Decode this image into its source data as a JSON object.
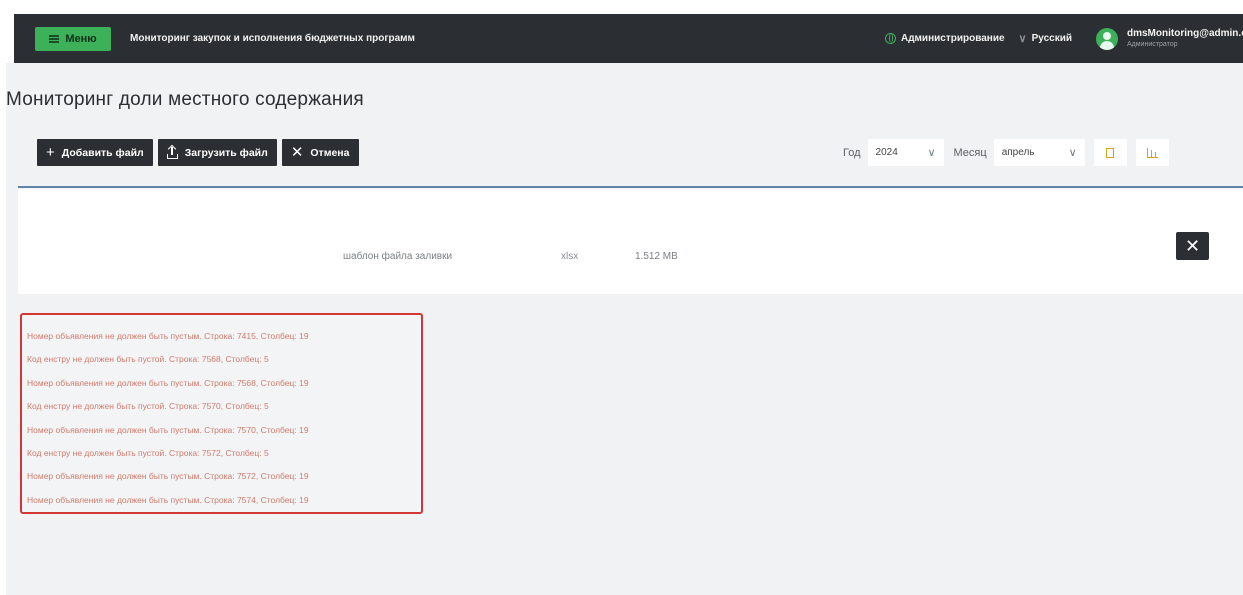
{
  "header": {
    "menu_label": "Меню",
    "app_title": "Мониторинг закупок и исполнения бюджетных программ",
    "admin_label": "Администрирование",
    "language_label": "Русский",
    "user_email": "dmsMonitoring@admin.com",
    "user_role": "Администратор"
  },
  "page": {
    "title": "Мониторинг доли местного содержания"
  },
  "toolbar": {
    "add_file": "Добавить файл",
    "upload_file": "Загрузить файл",
    "cancel": "Отмена"
  },
  "filters": {
    "year_label": "Год",
    "year_value": "2024",
    "month_label": "Месяц",
    "month_value": "апрель"
  },
  "file": {
    "name": "шаблон файла заливки",
    "extension": "xlsx",
    "size": "1.512 MB"
  },
  "errors": [
    "Номер объявления не должен быть пустым. Строка: 7415, Столбец: 19",
    "Код енстру не должен быть пустой. Строка: 7568, Столбец: 5",
    "Номер объявления не должен быть пустым. Строка: 7568, Столбец: 19",
    "Код енстру не должен быть пустой. Строка: 7570, Столбец: 5",
    "Номер объявления не должен быть пустым. Строка: 7570, Столбец: 19",
    "Код енстру не должен быть пустой. Строка: 7572, Столбец: 5",
    "Номер объявления не должен быть пустым. Строка: 7572, Столбец: 19",
    "Номер объявления не должен быть пустым. Строка: 7574, Столбец: 19"
  ],
  "icons": {
    "menu": "menu-icon",
    "admin": "globe-icon",
    "user": "user-avatar-icon",
    "add": "plus-icon",
    "upload": "upload-icon",
    "cancel": "close-icon",
    "export_doc": "document-icon",
    "export_chart": "bar-chart-icon",
    "remove_file": "close-icon"
  },
  "colors": {
    "header_bg": "#2b2f34",
    "accent_green": "#3cb15a",
    "error_border": "#d43535",
    "error_text": "#d07b6c",
    "divider": "#5f84ab"
  }
}
